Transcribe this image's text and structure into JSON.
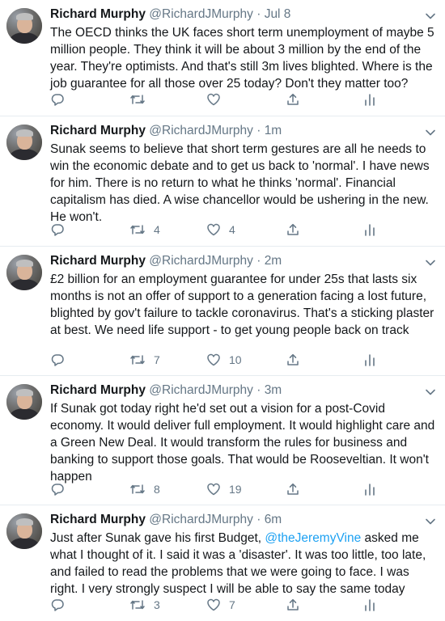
{
  "colors": {
    "link": "#1da1f2",
    "secondary": "#657786",
    "text": "#14171a",
    "divider": "#e6ecf0"
  },
  "tweets": [
    {
      "name": "Richard Murphy",
      "handle": "@RichardJMurphy",
      "dot": "·",
      "time": "Jul 8",
      "text": "The OECD thinks the UK faces short term unemployment of maybe 5 million people. They think it will be about 3 million by the end of the year. They're optimists. And that's still 3m lives blighted. Where is the job guarantee for all those over 25 today? Don't they matter too?",
      "retweets": "",
      "likes": ""
    },
    {
      "name": "Richard Murphy",
      "handle": "@RichardJMurphy",
      "dot": "·",
      "time": "1m",
      "text": "Sunak seems to believe that short term gestures are all he needs to win the economic debate and to get us back to 'normal'. I have news for him. There is no return to what he thinks 'normal'. Financial capitalism has died. A wise chancellor would be ushering in the new. He won't.",
      "retweets": "4",
      "likes": "4"
    },
    {
      "name": "Richard Murphy",
      "handle": "@RichardJMurphy",
      "dot": "·",
      "time": "2m",
      "text": "£2 billion for an employment guarantee for under 25s that lasts six months is not an offer of support to a generation facing a lost future, blighted by gov't failure to tackle coronavirus. That's a sticking plaster at best. We need life support - to get young people back on track",
      "retweets": "7",
      "likes": "10"
    },
    {
      "name": "Richard Murphy",
      "handle": "@RichardJMurphy",
      "dot": "·",
      "time": "3m",
      "text": "If Sunak got today right he'd set out a vision for a post-Covid economy. It would deliver full employment. It would highlight care and a Green New Deal. It would transform the rules for business and banking to support those goals. That would be Rooseveltian. It won't happen",
      "retweets": "8",
      "likes": "19"
    },
    {
      "name": "Richard Murphy",
      "handle": "@RichardJMurphy",
      "dot": "·",
      "time": "6m",
      "text_before": "Just after Sunak gave his first Budget, ",
      "mention": "@theJeremyVine",
      "text_after": " asked me what I thought of it. I said it was a 'disaster'. It was too little, too late, and failed to read the problems that we were going to face. I was right. I very strongly suspect I will be able to say the same today",
      "retweets": "3",
      "likes": "7"
    }
  ]
}
